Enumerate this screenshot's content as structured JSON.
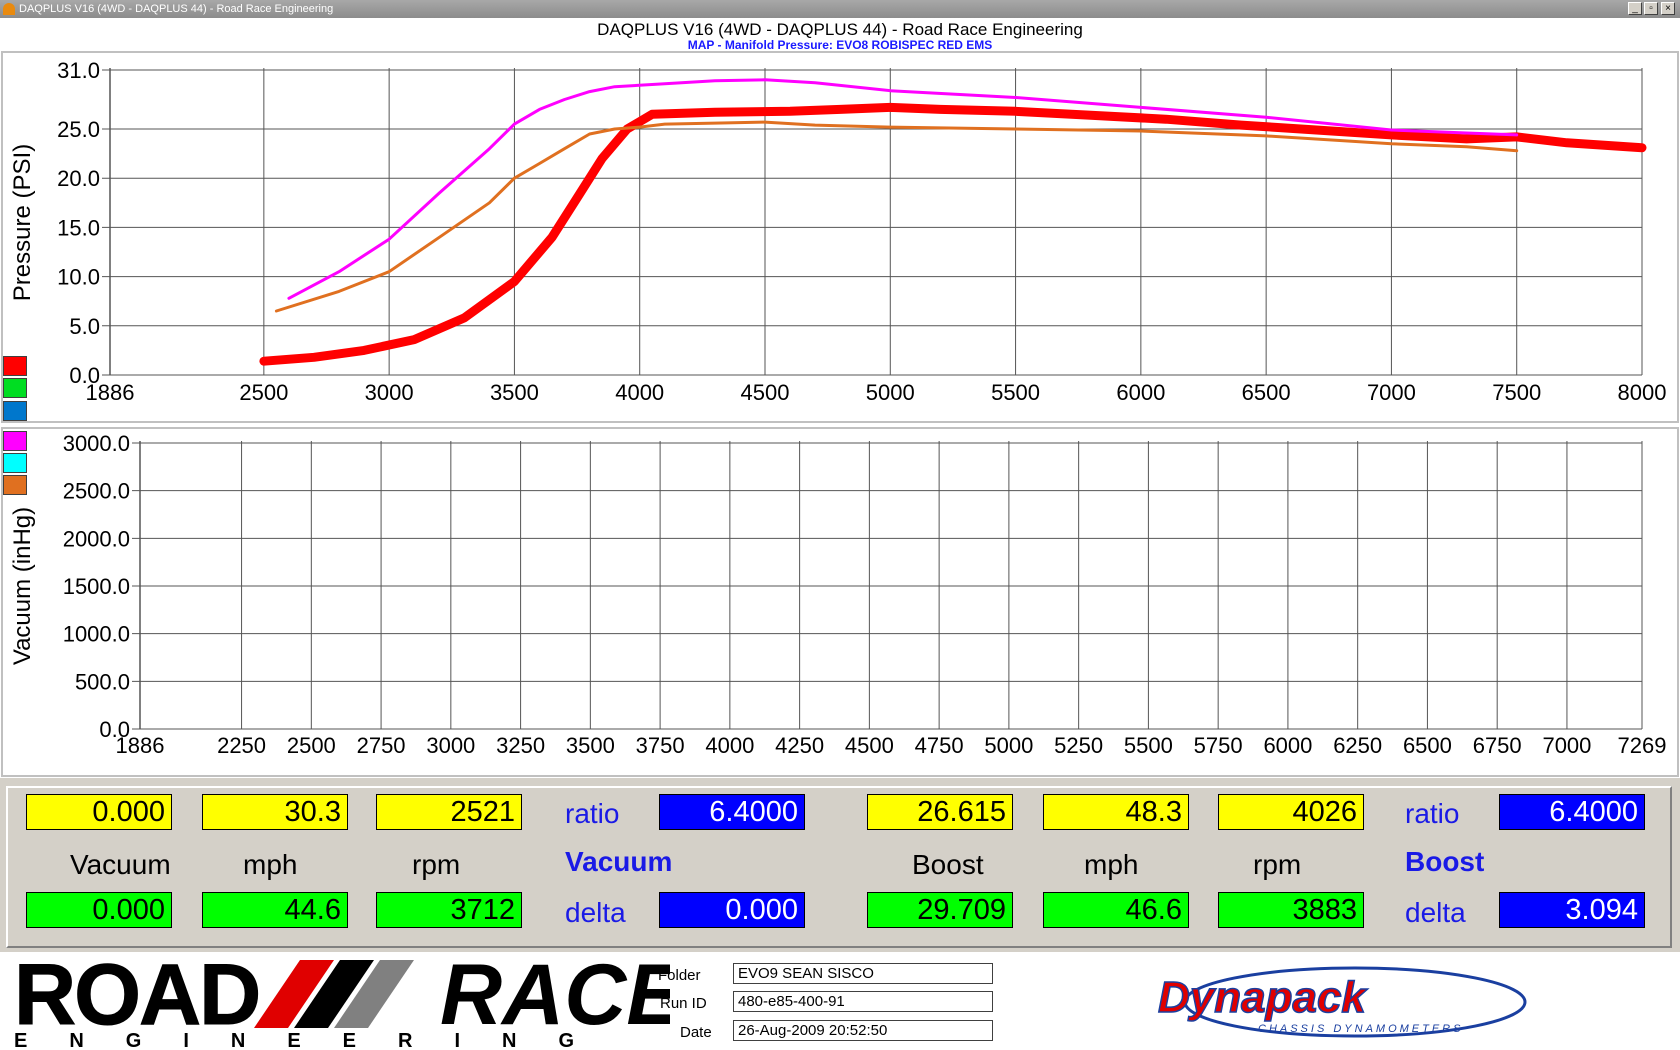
{
  "window": {
    "title": "DAQPLUS V16 (4WD - DAQPLUS 44) - Road Race Engineering",
    "btn_min": "_",
    "btn_restore": "▫",
    "btn_close": "×"
  },
  "header": {
    "title": "DAQPLUS V16 (4WD - DAQPLUS 44) - Road Race Engineering",
    "subtitle": "MAP - Manifold Pressure: EVO8 ROBISPEC RED EMS"
  },
  "legend": {
    "colors": [
      "#ff0000",
      "#00dd22",
      "#0077cc",
      "#ff00ff",
      "#00ffff",
      "#e07020"
    ]
  },
  "chart_data": [
    {
      "type": "line",
      "ylabel": "Pressure (PSI)",
      "xlim": [
        1886,
        8000
      ],
      "ylim": [
        0,
        31
      ],
      "x_ticks": [
        "1886",
        "2500",
        "3000",
        "3500",
        "4000",
        "4500",
        "5000",
        "5500",
        "6000",
        "6500",
        "7000",
        "7500",
        "8000"
      ],
      "x_tick_values": [
        1886,
        2500,
        3000,
        3500,
        4000,
        4500,
        5000,
        5500,
        6000,
        6500,
        7000,
        7500,
        8000
      ],
      "y_ticks": [
        "0.0",
        "5.0",
        "10.0",
        "15.0",
        "20.0",
        "25.0",
        "31.0"
      ],
      "y_tick_values": [
        0,
        5,
        10,
        15,
        20,
        25,
        31
      ],
      "grid": true,
      "series": [
        {
          "color": "#ff0000",
          "stroke": "thick",
          "x": [
            2500,
            2700,
            2900,
            3100,
            3300,
            3500,
            3650,
            3750,
            3850,
            3950,
            4050,
            4300,
            4600,
            4800,
            5000,
            5200,
            5500,
            5800,
            6100,
            6400,
            6700,
            7000,
            7300,
            7500,
            7700,
            8000
          ],
          "y": [
            1.4,
            1.8,
            2.5,
            3.6,
            5.8,
            9.5,
            14.0,
            18.0,
            22.0,
            25.0,
            26.5,
            26.7,
            26.8,
            27.0,
            27.2,
            27.0,
            26.8,
            26.4,
            26.0,
            25.4,
            24.9,
            24.4,
            24.0,
            24.2,
            23.6,
            23.1
          ]
        },
        {
          "color": "#ff00ff",
          "stroke": "normal",
          "x": [
            2600,
            2800,
            3000,
            3200,
            3400,
            3500,
            3600,
            3700,
            3800,
            3900,
            4100,
            4300,
            4500,
            4700,
            5000,
            5500,
            6000,
            6500,
            7000,
            7300,
            7500
          ],
          "y": [
            7.8,
            10.5,
            13.8,
            18.5,
            23.0,
            25.5,
            27.0,
            28.0,
            28.8,
            29.3,
            29.6,
            29.9,
            30.0,
            29.7,
            28.9,
            28.2,
            27.2,
            26.2,
            24.9,
            24.6,
            24.4
          ]
        },
        {
          "color": "#e07020",
          "stroke": "normal",
          "x": [
            2550,
            2800,
            3000,
            3200,
            3400,
            3500,
            3600,
            3700,
            3800,
            3900,
            4000,
            4100,
            4300,
            4500,
            4700,
            5000,
            5500,
            6000,
            6500,
            7000,
            7300,
            7500
          ],
          "y": [
            6.5,
            8.5,
            10.5,
            14.0,
            17.5,
            20.0,
            21.5,
            23.0,
            24.5,
            25.0,
            25.2,
            25.5,
            25.6,
            25.7,
            25.4,
            25.2,
            25.0,
            24.8,
            24.3,
            23.5,
            23.2,
            22.8
          ]
        }
      ]
    },
    {
      "type": "line",
      "ylabel": "Vacuum (inHg)",
      "xlim": [
        1886,
        7269
      ],
      "ylim": [
        0,
        3000
      ],
      "x_ticks": [
        "1886",
        "2250",
        "2500",
        "2750",
        "3000",
        "3250",
        "3500",
        "3750",
        "4000",
        "4250",
        "4500",
        "4750",
        "5000",
        "5250",
        "5500",
        "5750",
        "6000",
        "6250",
        "6500",
        "6750",
        "7000",
        "7269"
      ],
      "x_tick_values": [
        1886,
        2250,
        2500,
        2750,
        3000,
        3250,
        3500,
        3750,
        4000,
        4250,
        4500,
        4750,
        5000,
        5250,
        5500,
        5750,
        6000,
        6250,
        6500,
        6750,
        7000,
        7269
      ],
      "y_ticks": [
        "0.0",
        "500.0",
        "1000.0",
        "1500.0",
        "2000.0",
        "2500.0",
        "3000.0"
      ],
      "y_tick_values": [
        0,
        500,
        1000,
        1500,
        2000,
        2500,
        3000
      ],
      "grid": true,
      "series": []
    }
  ],
  "readouts": {
    "left": {
      "vacuum_top": "0.000",
      "mph_top": "30.3",
      "rpm_top": "2521",
      "ratio_label": "ratio",
      "ratio_value": "6.4000",
      "vacuum_label": "Vacuum",
      "mph_label": "mph",
      "rpm_label": "rpm",
      "section_label": "Vacuum",
      "vacuum_bottom": "0.000",
      "mph_bottom": "44.6",
      "rpm_bottom": "3712",
      "delta_label": "delta",
      "delta_value": "0.000"
    },
    "right": {
      "boost_top": "26.615",
      "mph_top": "48.3",
      "rpm_top": "4026",
      "ratio_label": "ratio",
      "ratio_value": "6.4000",
      "boost_label": "Boost",
      "mph_label": "mph",
      "rpm_label": "rpm",
      "section_label": "Boost",
      "boost_bottom": "29.709",
      "mph_bottom": "46.6",
      "rpm_bottom": "3883",
      "delta_label": "delta",
      "delta_value": "3.094"
    }
  },
  "footer": {
    "logo_word_1": "ROAD",
    "logo_word_2": "RACE",
    "logo_sub": "ENGINEERING",
    "folder_label": "Folder",
    "folder_value": "EVO9 SEAN SISCO",
    "runid_label": "Run ID",
    "runid_value": "480-e85-400-91",
    "date_label": "Date",
    "date_value": "26-Aug-2009  20:52:50",
    "brand_logo": "Dynapack",
    "brand_sub": "CHASSIS DYNAMOMETERS"
  }
}
